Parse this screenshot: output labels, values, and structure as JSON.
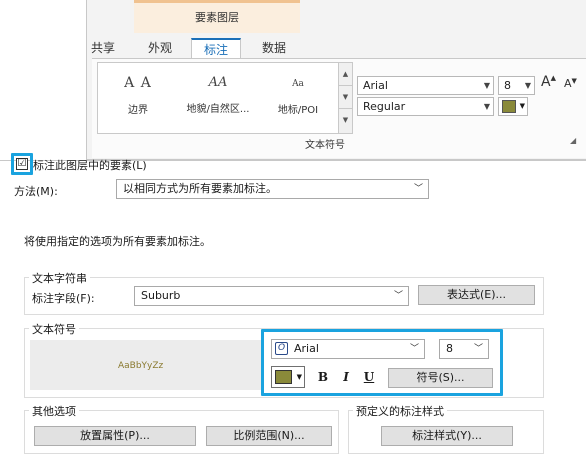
{
  "ribbon": {
    "context_group": "要素图层",
    "tabs": [
      {
        "label": "共享"
      },
      {
        "label": "外观"
      },
      {
        "label": "标注"
      },
      {
        "label": "数据"
      }
    ],
    "gallery": [
      {
        "glyph": "A A",
        "label": "边界"
      },
      {
        "glyph": "AA",
        "label": "地貌/自然区..."
      },
      {
        "glyph": "Aa",
        "label": "地标/POI"
      }
    ],
    "font_name": "Arial",
    "font_size": "8",
    "font_style": "Regular",
    "grow_font": "A",
    "shrink_font": "A",
    "group_label": "文本符号",
    "text_color": "#8a8a3a"
  },
  "dialog": {
    "label_checkbox": "标注此图层中的要素(L)",
    "label_checked": "☑",
    "method_label": "方法(M):",
    "method_value": "以相同方式为所有要素加标注。",
    "info_text": "将使用指定的选项为所有要素加标注。",
    "text_string": {
      "title": "文本字符串",
      "field_label": "标注字段(F):",
      "field_value": "Suburb",
      "expression_button": "表达式(E)..."
    },
    "text_symbol": {
      "title": "文本符号",
      "preview": "AaBbYyZz",
      "font_name": "Arial",
      "font_size": "8",
      "bold": "B",
      "italic": "I",
      "underline": "U",
      "symbol_button": "符号(S)...",
      "color": "#8a8a3a"
    },
    "other_options": {
      "title": "其他选项",
      "placement_button": "放置属性(P)...",
      "scale_button": "比例范围(N)..."
    },
    "predefined": {
      "title": "预定义的标注样式",
      "style_button": "标注样式(Y)..."
    }
  }
}
